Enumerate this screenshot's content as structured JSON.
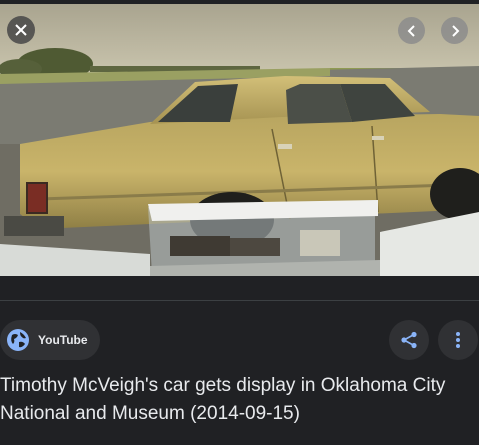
{
  "source": {
    "name": "YouTube",
    "icon": "globe-icon"
  },
  "title": "Timothy McVeigh's car gets display in Oklahoma City National and Museum (2014-09-15)",
  "actions": {
    "share_icon": "share-icon",
    "more_icon": "more-vert-icon"
  },
  "nav": {
    "close_icon": "close-icon",
    "prev_icon": "chevron-left-icon",
    "next_icon": "chevron-right-icon"
  },
  "colors": {
    "background": "#202124",
    "accent": "#8ab4f8",
    "chip": "#303134",
    "text": "#e8eaed"
  }
}
